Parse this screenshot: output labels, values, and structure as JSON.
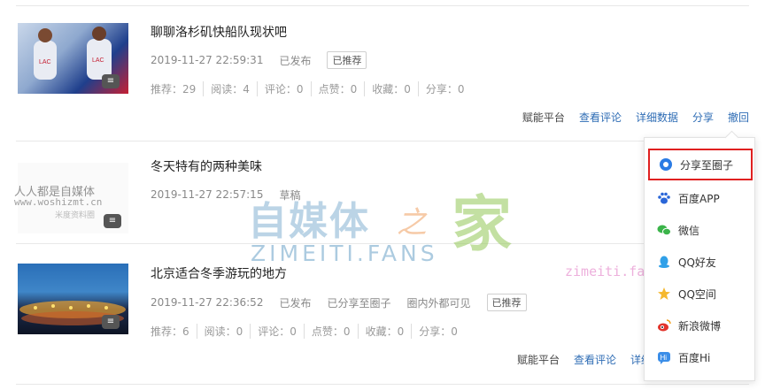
{
  "articles": [
    {
      "title": "聊聊洛杉矶快船队现状吧",
      "datetime": "2019-11-27 22:59:31",
      "status": "已发布",
      "badge": "已推荐",
      "stats": [
        "推荐：29",
        "阅读：4",
        "评论：0",
        "点赞：0",
        "收藏：0",
        "分享：0"
      ],
      "actions": [
        "赋能平台",
        "查看评论",
        "详细数据",
        "分享",
        "撤回"
      ]
    },
    {
      "title": "冬天特有的两种美味",
      "datetime": "2019-11-27 22:57:15",
      "status": "草稿"
    },
    {
      "title": "北京适合冬季游玩的地方",
      "datetime": "2019-11-27 22:36:52",
      "status": "已发布",
      "share_status": "已分享至圈子",
      "visibility": "圈内外都可见",
      "badge": "已推荐",
      "stats": [
        "推荐：6",
        "阅读：0",
        "评论：0",
        "点赞：0",
        "收藏：0",
        "分享：0"
      ],
      "actions": [
        "赋能平台",
        "查看评论",
        "详细"
      ]
    }
  ],
  "share_menu": [
    {
      "label": "分享至圈子",
      "icon": "circle-icon",
      "color": "#2a7be4",
      "highlighted": true
    },
    {
      "label": "百度APP",
      "icon": "baidu-paw-icon",
      "color": "#2a66d8"
    },
    {
      "label": "微信",
      "icon": "wechat-icon",
      "color": "#3bb44a"
    },
    {
      "label": "QQ好友",
      "icon": "qq-icon",
      "color": "#30a0e8"
    },
    {
      "label": "QQ空间",
      "icon": "qzone-star-icon",
      "color": "#f5b82e"
    },
    {
      "label": "新浪微博",
      "icon": "weibo-icon",
      "color": "#e2342b"
    },
    {
      "label": "百度Hi",
      "icon": "baidu-hi-icon",
      "color": "#3b8ee8"
    }
  ],
  "watermark": {
    "small_cn": "人人都是自媒体",
    "small_url": "www.woshizmt.cn",
    "tiny": "米度资料圈",
    "big_cn": "自媒体",
    "zhi": "之",
    "jia": "家",
    "big_en": "ZIMEITI.FANS",
    "fans": "zimeiti.fans"
  },
  "colors": {
    "link": "#2f6db5",
    "highlight_border": "#e02020"
  }
}
